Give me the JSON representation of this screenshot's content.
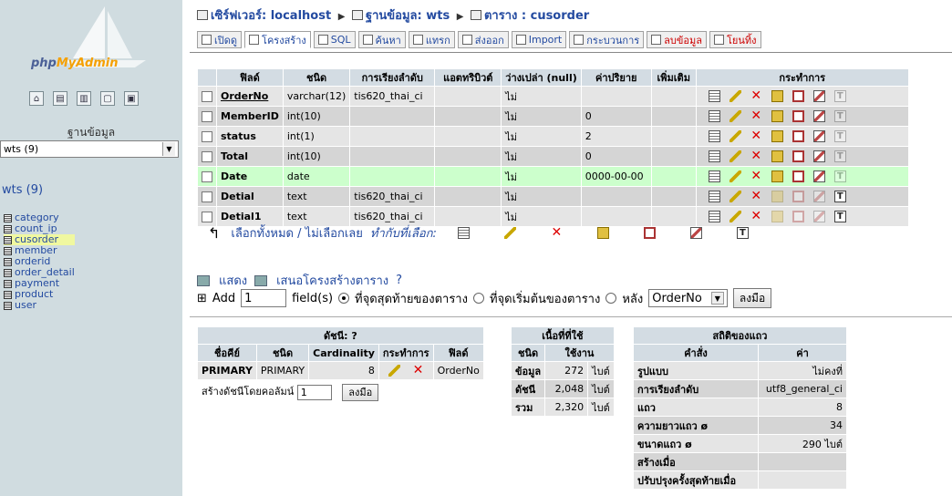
{
  "nav": {
    "logo_text_a": "php",
    "logo_text_b": "MyAdmin",
    "db_label": "ฐานข้อมูล",
    "db_selected": "wts (9)",
    "db_heading": "wts (9)",
    "tables": [
      "category",
      "count_ip",
      "cusorder",
      "member",
      "orderid",
      "order_detail",
      "payment",
      "product",
      "user"
    ],
    "active_table": "cusorder"
  },
  "breadcrumb": {
    "server": "เซิร์ฟเวอร์: localhost",
    "database": "ฐานข้อมูล: wts",
    "table": "ตาราง : cusorder"
  },
  "tabs": [
    "เปิดดู",
    "โครงสร้าง",
    "SQL",
    "ค้นหา",
    "แทรก",
    "ส่งออก",
    "Import",
    "กระบวนการ",
    "ลบข้อมูล",
    "โยนทิ้ง"
  ],
  "structure": {
    "headers": [
      "ฟิลด์",
      "ชนิด",
      "การเรียงลำดับ",
      "แอตทริบิวต์",
      "ว่างเปล่า (null)",
      "ค่าปริยาย",
      "เพิ่มเติม",
      "กระทำการ"
    ],
    "rows": [
      {
        "field": "OrderNo",
        "type": "varchar(12)",
        "collation": "tis620_thai_ci",
        "attr": "",
        "null": "ไม่",
        "default": "",
        "extra": ""
      },
      {
        "field": "MemberID",
        "type": "int(10)",
        "collation": "",
        "attr": "",
        "null": "ไม่",
        "default": "0",
        "extra": ""
      },
      {
        "field": "status",
        "type": "int(1)",
        "collation": "",
        "attr": "",
        "null": "ไม่",
        "default": "2",
        "extra": ""
      },
      {
        "field": "Total",
        "type": "int(10)",
        "collation": "",
        "attr": "",
        "null": "ไม่",
        "default": "0",
        "extra": ""
      },
      {
        "field": "Date",
        "type": "date",
        "collation": "",
        "attr": "",
        "null": "ไม่",
        "default": "0000-00-00",
        "extra": ""
      },
      {
        "field": "Detial",
        "type": "text",
        "collation": "tis620_thai_ci",
        "attr": "",
        "null": "ไม่",
        "default": "",
        "extra": ""
      },
      {
        "field": "Detial1",
        "type": "text",
        "collation": "tis620_thai_ci",
        "attr": "",
        "null": "ไม่",
        "default": "",
        "extra": ""
      }
    ]
  },
  "checkall": {
    "check_all": "เลือกทั้งหมด",
    "separator": " / ",
    "uncheck_all": "ไม่เลือกเลย",
    "with_selected": "ทำกับที่เลือก:"
  },
  "links": {
    "print_view": "แสดง",
    "propose_structure": "เสนอโครงสร้างตาราง"
  },
  "add_field": {
    "label": "Add",
    "count": "1",
    "fields_text": "field(s)",
    "opt_end": "ที่จุดสุดท้ายของตาราง",
    "opt_begin": "ที่จุดเริ่มต้นของตาราง",
    "opt_after": "หลัง",
    "after_field": "OrderNo",
    "go": "ลงมือ"
  },
  "indexes": {
    "title": "ดัชนี:",
    "headers": [
      "ชื่อคีย์",
      "ชนิด",
      "Cardinality",
      "กระทำการ",
      "ฟิลด์"
    ],
    "rows": [
      {
        "keyname": "PRIMARY",
        "type": "PRIMARY",
        "cardinality": "8",
        "field": "OrderNo"
      }
    ],
    "create_label": "สร้างดัชนีโดยคอลัมน์",
    "create_count": "1",
    "go": "ลงมือ"
  },
  "space": {
    "title": "เนื้อที่ที่ใช้",
    "headers": [
      "ชนิด",
      "ใช้งาน"
    ],
    "rows": [
      {
        "type": "ข้อมูล",
        "value": "272",
        "unit": "ไบต์"
      },
      {
        "type": "ดัชนี",
        "value": "2,048",
        "unit": "ไบต์"
      },
      {
        "type": "รวม",
        "value": "2,320",
        "unit": "ไบต์"
      }
    ]
  },
  "stats": {
    "title": "สถิติของแถว",
    "headers": [
      "คำสั่ง",
      "ค่า"
    ],
    "rows": [
      {
        "label": "รูปแบบ",
        "value": "ไม่คงที่"
      },
      {
        "label": "การเรียงลำดับ",
        "value": "utf8_general_ci"
      },
      {
        "label": "แถว",
        "value": "8"
      },
      {
        "label": "ความยาวแถว ø",
        "value": "34"
      },
      {
        "label": "ขนาดแถว ø",
        "value": "290 ไบต์"
      },
      {
        "label": "สร้างเมื่อ",
        "value": ""
      },
      {
        "label": "ปรับปรุงครั้งสุดท้ายเมื่อ",
        "value": ""
      }
    ]
  }
}
